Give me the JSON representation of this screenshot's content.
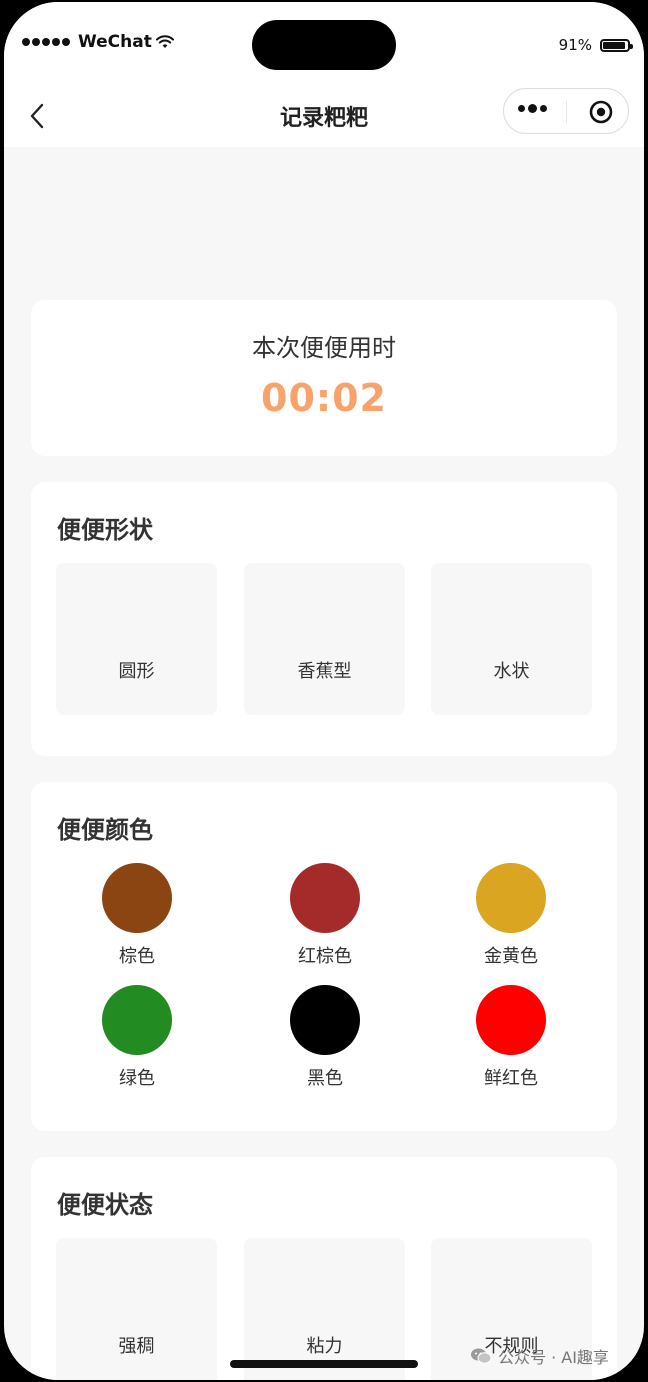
{
  "status_bar": {
    "carrier": "WeChat",
    "battery_percent": "91%",
    "battery_level": 0.91
  },
  "navbar": {
    "title": "记录粑粑"
  },
  "timer": {
    "label": "本次便便用时",
    "value": "00:02",
    "color": "#f9a36a"
  },
  "shape_section": {
    "title": "便便形状",
    "options": [
      "圆形",
      "香蕉型",
      "水状"
    ]
  },
  "color_section": {
    "title": "便便颜色",
    "options": [
      {
        "label": "棕色",
        "color": "#8b4513"
      },
      {
        "label": "红棕色",
        "color": "#a52a2a"
      },
      {
        "label": "金黄色",
        "color": "#daa520"
      },
      {
        "label": "绿色",
        "color": "#228b22"
      },
      {
        "label": "黑色",
        "color": "#000000"
      },
      {
        "label": "鲜红色",
        "color": "#ff0000"
      }
    ]
  },
  "state_section": {
    "title": "便便状态",
    "options": [
      "强稠",
      "粘力",
      "不规则"
    ]
  },
  "watermark": {
    "text": "公众号 · AI趣享"
  }
}
